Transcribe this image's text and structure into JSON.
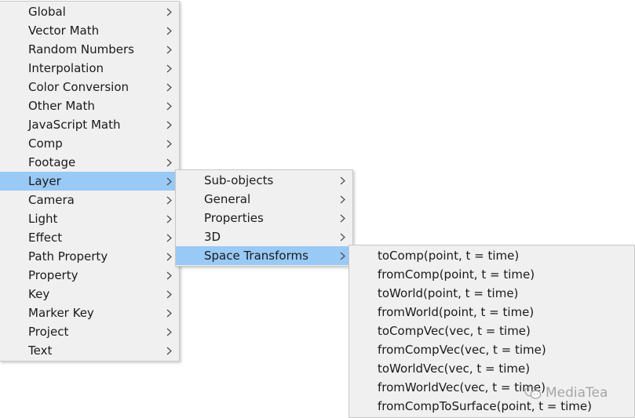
{
  "menu_main": {
    "items": [
      {
        "label": "Global"
      },
      {
        "label": "Vector Math"
      },
      {
        "label": "Random Numbers"
      },
      {
        "label": "Interpolation"
      },
      {
        "label": "Color Conversion"
      },
      {
        "label": "Other Math"
      },
      {
        "label": "JavaScript Math"
      },
      {
        "label": "Comp"
      },
      {
        "label": "Footage"
      },
      {
        "label": "Layer",
        "selected": true
      },
      {
        "label": "Camera"
      },
      {
        "label": "Light"
      },
      {
        "label": "Effect"
      },
      {
        "label": "Path Property"
      },
      {
        "label": "Property"
      },
      {
        "label": "Key"
      },
      {
        "label": "Marker Key"
      },
      {
        "label": "Project"
      },
      {
        "label": "Text"
      }
    ]
  },
  "menu_layer": {
    "items": [
      {
        "label": "Sub-objects"
      },
      {
        "label": "General"
      },
      {
        "label": "Properties"
      },
      {
        "label": "3D"
      },
      {
        "label": "Space Transforms",
        "selected": true
      }
    ]
  },
  "menu_space_transforms": {
    "items": [
      {
        "label": "toComp(point, t = time)"
      },
      {
        "label": "fromComp(point, t = time)"
      },
      {
        "label": "toWorld(point, t = time)"
      },
      {
        "label": "fromWorld(point, t = time)"
      },
      {
        "label": "toCompVec(vec, t = time)"
      },
      {
        "label": "fromCompVec(vec, t = time)"
      },
      {
        "label": "toWorldVec(vec, t = time)"
      },
      {
        "label": "fromWorldVec(vec, t = time)"
      },
      {
        "label": "fromCompToSurface(point, t = time)"
      }
    ]
  },
  "watermark": {
    "text": "MediaTea",
    "icon": "wechat-icon"
  },
  "colors": {
    "menu_bg": "#f0f0f0",
    "selected_bg": "#99c9f5",
    "border": "#c8c8c8",
    "text": "#1a1a1a"
  }
}
